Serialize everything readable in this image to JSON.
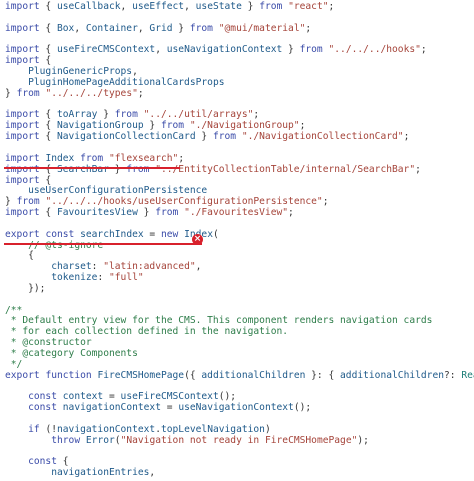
{
  "editor": {
    "lines": [
      [
        [
          "kw",
          "import"
        ],
        [
          "pl",
          " { "
        ],
        [
          "id",
          "useCallback"
        ],
        [
          "pl",
          ", "
        ],
        [
          "id",
          "useEffect"
        ],
        [
          "pl",
          ", "
        ],
        [
          "id",
          "useState"
        ],
        [
          "pl",
          " } "
        ],
        [
          "kw",
          "from"
        ],
        [
          "pl",
          " "
        ],
        [
          "str",
          "\"react\""
        ],
        [
          "pl",
          ";"
        ]
      ],
      [],
      [
        [
          "kw",
          "import"
        ],
        [
          "pl",
          " { "
        ],
        [
          "id",
          "Box"
        ],
        [
          "pl",
          ", "
        ],
        [
          "id",
          "Container"
        ],
        [
          "pl",
          ", "
        ],
        [
          "id",
          "Grid"
        ],
        [
          "pl",
          " } "
        ],
        [
          "kw",
          "from"
        ],
        [
          "pl",
          " "
        ],
        [
          "str",
          "\"@mui/material\""
        ],
        [
          "pl",
          ";"
        ]
      ],
      [],
      [
        [
          "kw",
          "import"
        ],
        [
          "pl",
          " { "
        ],
        [
          "id",
          "useFireCMSContext"
        ],
        [
          "pl",
          ", "
        ],
        [
          "id",
          "useNavigationContext"
        ],
        [
          "pl",
          " } "
        ],
        [
          "kw",
          "from"
        ],
        [
          "pl",
          " "
        ],
        [
          "str",
          "\"../../../hooks\""
        ],
        [
          "pl",
          ";"
        ]
      ],
      [
        [
          "kw",
          "import"
        ],
        [
          "pl",
          " {"
        ]
      ],
      [
        [
          "pl",
          "    "
        ],
        [
          "id",
          "PluginGenericProps"
        ],
        [
          "pl",
          ","
        ]
      ],
      [
        [
          "pl",
          "    "
        ],
        [
          "id",
          "PluginHomePageAdditionalCardsProps"
        ]
      ],
      [
        [
          "pl",
          "} "
        ],
        [
          "kw",
          "from"
        ],
        [
          "pl",
          " "
        ],
        [
          "str",
          "\"../../../types\""
        ],
        [
          "pl",
          ";"
        ]
      ],
      [],
      [
        [
          "kw",
          "import"
        ],
        [
          "pl",
          " { "
        ],
        [
          "id",
          "toArray"
        ],
        [
          "pl",
          " } "
        ],
        [
          "kw",
          "from"
        ],
        [
          "pl",
          " "
        ],
        [
          "str",
          "\"../../util/arrays\""
        ],
        [
          "pl",
          ";"
        ]
      ],
      [
        [
          "kw",
          "import"
        ],
        [
          "pl",
          " { "
        ],
        [
          "id",
          "NavigationGroup"
        ],
        [
          "pl",
          " } "
        ],
        [
          "kw",
          "from"
        ],
        [
          "pl",
          " "
        ],
        [
          "str",
          "\"./NavigationGroup\""
        ],
        [
          "pl",
          ";"
        ]
      ],
      [
        [
          "kw",
          "import"
        ],
        [
          "pl",
          " { "
        ],
        [
          "id",
          "NavigationCollectionCard"
        ],
        [
          "pl",
          " } "
        ],
        [
          "kw",
          "from"
        ],
        [
          "pl",
          " "
        ],
        [
          "str",
          "\"./NavigationCollectionCard\""
        ],
        [
          "pl",
          ";"
        ]
      ],
      [],
      [
        [
          "kw",
          "import"
        ],
        [
          "pl",
          " "
        ],
        [
          "id",
          "Index"
        ],
        [
          "pl",
          " "
        ],
        [
          "kw",
          "from"
        ],
        [
          "pl",
          " "
        ],
        [
          "str",
          "\"flexsearch\""
        ],
        [
          "pl",
          ";"
        ]
      ],
      [
        [
          "kw",
          "import"
        ],
        [
          "pl",
          " { "
        ],
        [
          "id",
          "SearchBar"
        ],
        [
          "pl",
          " } "
        ],
        [
          "kw",
          "from"
        ],
        [
          "pl",
          " "
        ],
        [
          "str",
          "\"../EntityCollectionTable/internal/SearchBar\""
        ],
        [
          "pl",
          ";"
        ]
      ],
      [
        [
          "kw",
          "import"
        ],
        [
          "pl",
          " {"
        ]
      ],
      [
        [
          "pl",
          "    "
        ],
        [
          "id",
          "useUserConfigurationPersistence"
        ]
      ],
      [
        [
          "pl",
          "} "
        ],
        [
          "kw",
          "from"
        ],
        [
          "pl",
          " "
        ],
        [
          "str",
          "\"../../../hooks/useUserConfigurationPersistence\""
        ],
        [
          "pl",
          ";"
        ]
      ],
      [
        [
          "kw",
          "import"
        ],
        [
          "pl",
          " { "
        ],
        [
          "id",
          "FavouritesView"
        ],
        [
          "pl",
          " } "
        ],
        [
          "kw",
          "from"
        ],
        [
          "pl",
          " "
        ],
        [
          "str",
          "\"./FavouritesView\""
        ],
        [
          "pl",
          ";"
        ]
      ],
      [],
      [
        [
          "kw",
          "export"
        ],
        [
          "pl",
          " "
        ],
        [
          "kw",
          "const"
        ],
        [
          "pl",
          " "
        ],
        [
          "id",
          "searchIndex"
        ],
        [
          "pl",
          " = "
        ],
        [
          "kw",
          "new"
        ],
        [
          "pl",
          " "
        ],
        [
          "id",
          "Index"
        ],
        [
          "pl",
          "("
        ]
      ],
      [
        [
          "pl",
          "    "
        ],
        [
          "cm",
          "// @ts-ignore"
        ]
      ],
      [
        [
          "pl",
          "    {"
        ]
      ],
      [
        [
          "pl",
          "        "
        ],
        [
          "id",
          "charset"
        ],
        [
          "pl",
          ": "
        ],
        [
          "str",
          "\"latin:advanced\""
        ],
        [
          "pl",
          ","
        ]
      ],
      [
        [
          "pl",
          "        "
        ],
        [
          "id",
          "tokenize"
        ],
        [
          "pl",
          ": "
        ],
        [
          "str",
          "\"full\""
        ]
      ],
      [
        [
          "pl",
          "    });"
        ]
      ],
      [],
      [
        [
          "cm",
          "/**"
        ]
      ],
      [
        [
          "cm",
          " * Default entry view for the CMS. This component renders navigation cards"
        ]
      ],
      [
        [
          "cm",
          " * for each collection defined in the navigation."
        ]
      ],
      [
        [
          "cm",
          " * @constructor"
        ]
      ],
      [
        [
          "cm",
          " * @category Components"
        ]
      ],
      [
        [
          "cm",
          " */"
        ]
      ],
      [
        [
          "kw",
          "export"
        ],
        [
          "pl",
          " "
        ],
        [
          "kw",
          "function"
        ],
        [
          "pl",
          " "
        ],
        [
          "id",
          "FireCMSHomePage"
        ],
        [
          "pl",
          "({ "
        ],
        [
          "id",
          "additionalChildren"
        ],
        [
          "pl",
          " }: { "
        ],
        [
          "id",
          "additionalChildren"
        ],
        [
          "pl",
          "?: "
        ],
        [
          "type",
          "React.ReactNode"
        ]
      ],
      [],
      [
        [
          "pl",
          "    "
        ],
        [
          "kw",
          "const"
        ],
        [
          "pl",
          " "
        ],
        [
          "id",
          "context"
        ],
        [
          "pl",
          " = "
        ],
        [
          "id",
          "useFireCMSContext"
        ],
        [
          "pl",
          "();"
        ]
      ],
      [
        [
          "pl",
          "    "
        ],
        [
          "kw",
          "const"
        ],
        [
          "pl",
          " "
        ],
        [
          "id",
          "navigationContext"
        ],
        [
          "pl",
          " = "
        ],
        [
          "id",
          "useNavigationContext"
        ],
        [
          "pl",
          "();"
        ]
      ],
      [],
      [
        [
          "pl",
          "    "
        ],
        [
          "kw",
          "if"
        ],
        [
          "pl",
          " (!"
        ],
        [
          "id",
          "navigationContext"
        ],
        [
          "pl",
          "."
        ],
        [
          "id",
          "topLevelNavigation"
        ],
        [
          "pl",
          ")"
        ]
      ],
      [
        [
          "pl",
          "        "
        ],
        [
          "kw",
          "throw"
        ],
        [
          "pl",
          " "
        ],
        [
          "id",
          "Error"
        ],
        [
          "pl",
          "("
        ],
        [
          "str",
          "\"Navigation not ready in FireCMSHomePage\""
        ],
        [
          "pl",
          ");"
        ]
      ],
      [],
      [
        [
          "pl",
          "    "
        ],
        [
          "kw",
          "const"
        ],
        [
          "pl",
          " {"
        ]
      ],
      [
        [
          "pl",
          "        "
        ],
        [
          "id",
          "navigationEntries"
        ],
        [
          "pl",
          ","
        ]
      ]
    ]
  },
  "colors": {
    "annotation": "#d8212c",
    "keyword": "#3a4ba8",
    "string": "#a5443a",
    "identifier": "#1f5a8a",
    "comment": "#2e7d4a",
    "type": "#1c7d76"
  },
  "error_marker": {
    "icon": "error-x-icon",
    "glyph": "×"
  }
}
